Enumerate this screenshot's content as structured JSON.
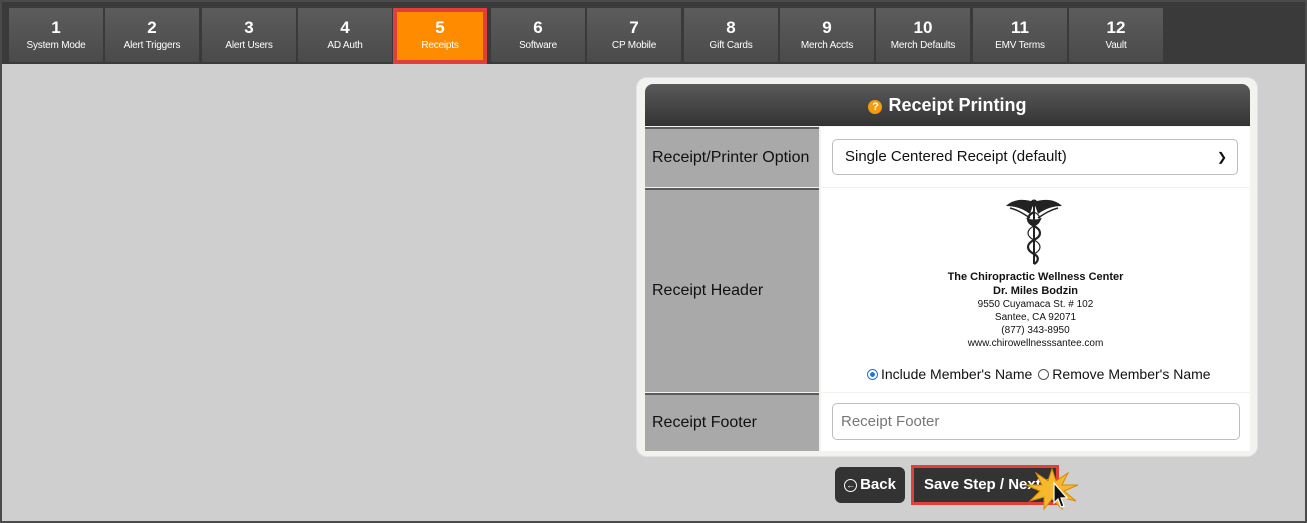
{
  "steps": [
    {
      "num": "1",
      "label": "System Mode"
    },
    {
      "num": "2",
      "label": "Alert Triggers"
    },
    {
      "num": "3",
      "label": "Alert Users"
    },
    {
      "num": "4",
      "label": "AD Auth"
    },
    {
      "num": "5",
      "label": "Receipts",
      "active": true
    },
    {
      "num": "6",
      "label": "Software"
    },
    {
      "num": "7",
      "label": "CP Mobile"
    },
    {
      "num": "8",
      "label": "Gift Cards"
    },
    {
      "num": "9",
      "label": "Merch Accts"
    },
    {
      "num": "10",
      "label": "Merch Defaults"
    },
    {
      "num": "11",
      "label": "EMV Terms"
    },
    {
      "num": "12",
      "label": "Vault"
    }
  ],
  "panel": {
    "title": "Receipt Printing",
    "help_icon": "help-icon",
    "printer_option": {
      "label": "Receipt/Printer Option",
      "selected": "Single Centered Receipt (default)"
    },
    "header": {
      "label": "Receipt Header",
      "line1": "The Chiropractic Wellness Center",
      "line2": "Dr. Miles Bodzin",
      "line3": "9550 Cuyamaca St. # 102",
      "line4": "Santee, CA 92071",
      "line5": "(877) 343-8950",
      "line6": "www.chirowellnesssantee.com",
      "radio_include": "Include Member's Name",
      "radio_remove": "Remove Member's Name",
      "include_selected": true
    },
    "footer": {
      "label": "Receipt Footer",
      "placeholder": "Receipt Footer",
      "value": ""
    }
  },
  "buttons": {
    "back": "Back",
    "save": "Save Step / Next Step"
  },
  "colors": {
    "accent": "#ff8c00",
    "highlight": "#e0403a",
    "header_bg": "#333333"
  }
}
